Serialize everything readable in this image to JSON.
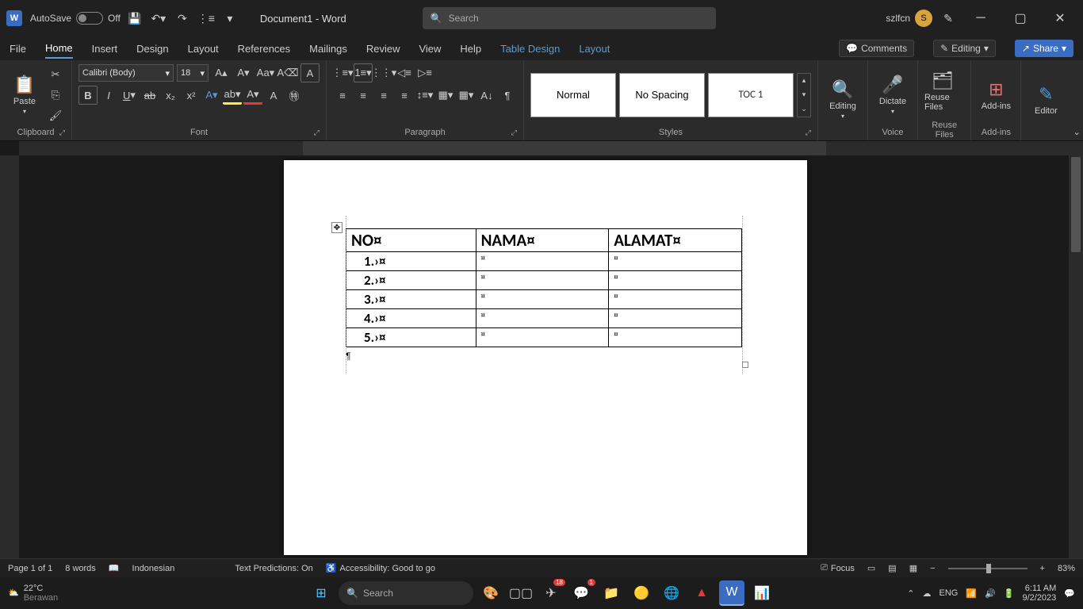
{
  "titlebar": {
    "app_letter": "W",
    "autosave_label": "AutoSave",
    "autosave_state": "Off",
    "doc_title": "Document1 - Word",
    "search_placeholder": "Search",
    "user_name": "szlfcn",
    "user_initial": "S"
  },
  "tabs": {
    "file": "File",
    "home": "Home",
    "insert": "Insert",
    "design": "Design",
    "layout": "Layout",
    "references": "References",
    "mailings": "Mailings",
    "review": "Review",
    "view": "View",
    "help": "Help",
    "table_design": "Table Design",
    "table_layout": "Layout",
    "comments": "Comments",
    "editing": "Editing",
    "share": "Share"
  },
  "ribbon": {
    "clipboard": {
      "paste": "Paste",
      "label": "Clipboard"
    },
    "font": {
      "name": "Calibri (Body)",
      "size": "18",
      "label": "Font"
    },
    "paragraph": {
      "label": "Paragraph"
    },
    "styles": {
      "normal": "Normal",
      "nospacing": "No Spacing",
      "toc1": "TOC 1",
      "label": "Styles"
    },
    "editing": {
      "label": "Editing"
    },
    "voice": {
      "dictate": "Dictate",
      "label": "Voice"
    },
    "reuse": {
      "btn": "Reuse Files",
      "label": "Reuse Files"
    },
    "addins": {
      "btn": "Add-ins",
      "label": "Add-ins"
    },
    "editor": {
      "btn": "Editor"
    }
  },
  "document": {
    "table": {
      "headers": [
        "NO¤",
        "NAMA¤",
        "ALAMAT¤"
      ],
      "rows": [
        [
          "1.›¤",
          "¤",
          "¤"
        ],
        [
          "2.›¤",
          "¤",
          "¤"
        ],
        [
          "3.›¤",
          "¤",
          "¤"
        ],
        [
          "4.›¤",
          "¤",
          "¤"
        ],
        [
          "5.›¤",
          "¤",
          "¤"
        ]
      ]
    },
    "pilcrow": "¶"
  },
  "statusbar": {
    "page": "Page 1 of 1",
    "words": "8 words",
    "language": "Indonesian",
    "predictions": "Text Predictions: On",
    "accessibility": "Accessibility: Good to go",
    "focus": "Focus",
    "zoom": "83%"
  },
  "taskbar": {
    "temp": "22°C",
    "weather": "Berawan",
    "search": "Search",
    "lang": "ENG",
    "time": "6:11 AM",
    "date": "9/2/2023"
  }
}
